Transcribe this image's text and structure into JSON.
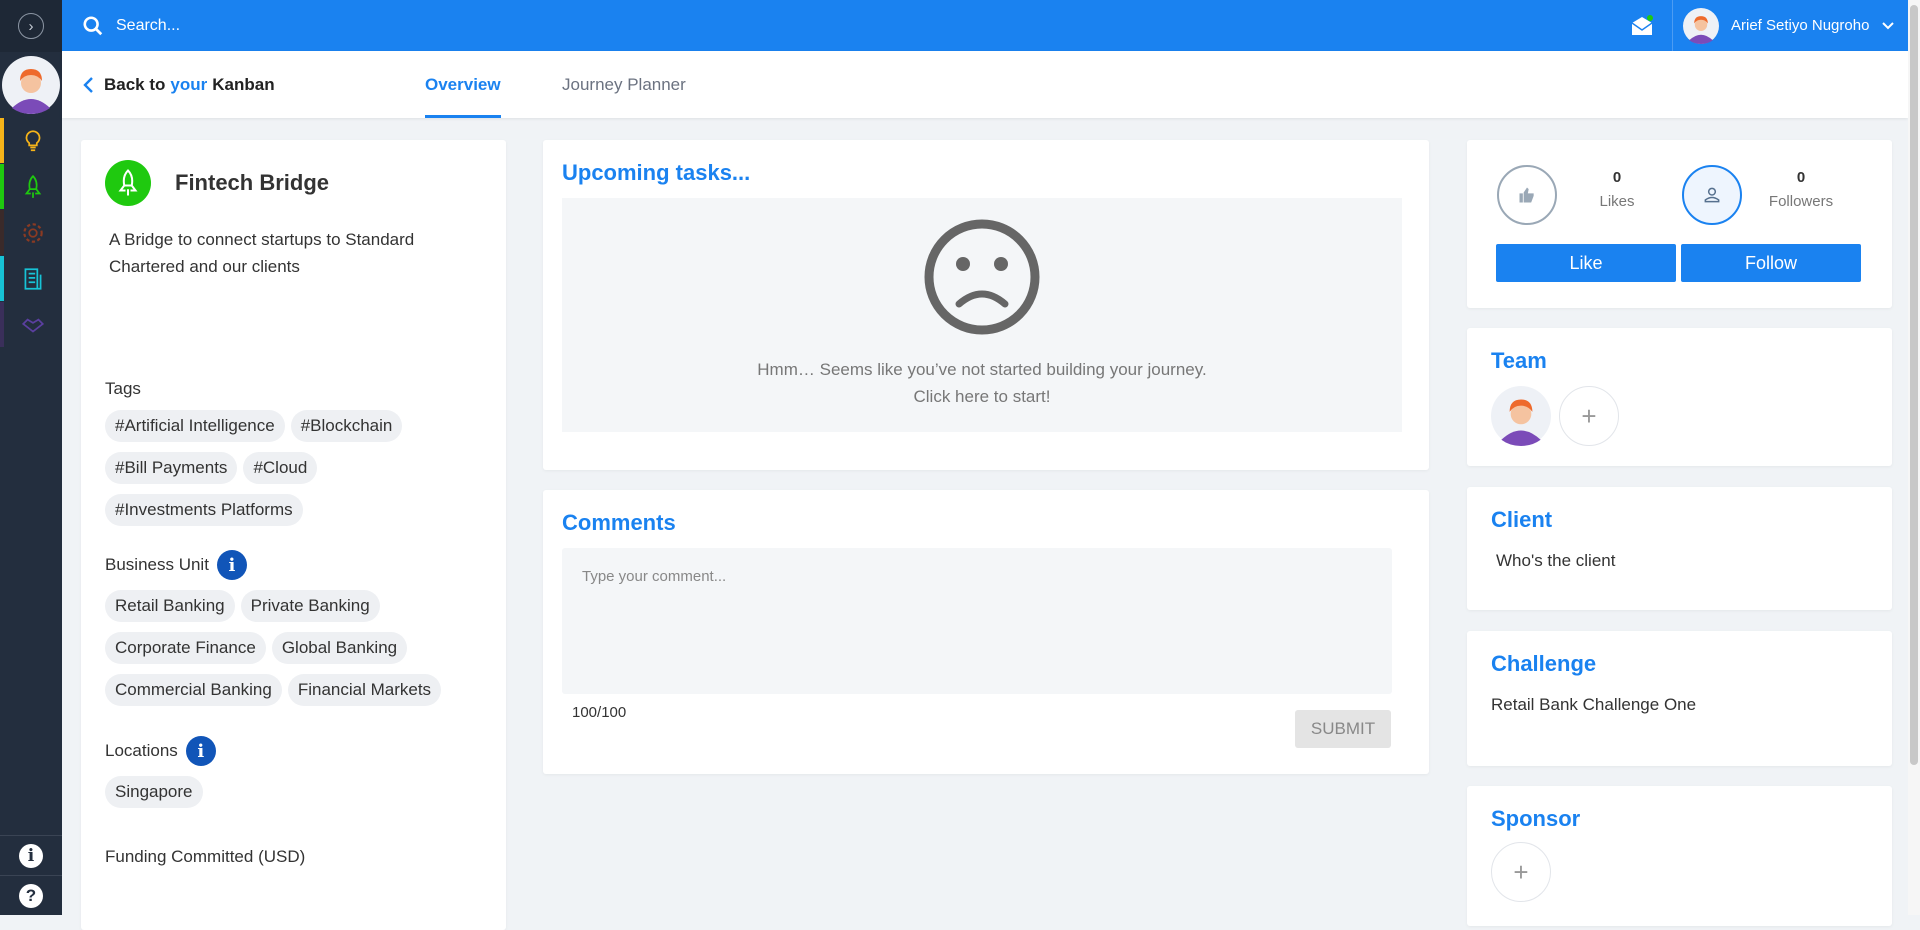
{
  "topbar": {
    "search_placeholder": "Search...",
    "user_name": "Arief Setiyo Nugroho"
  },
  "nav": {
    "back_prefix": "Back to",
    "back_your": "your",
    "back_suffix": "Kanban",
    "tabs": [
      {
        "label": "Overview",
        "active": true
      },
      {
        "label": "Journey Planner",
        "active": false
      }
    ]
  },
  "sidebar": {
    "items": [
      {
        "icon": "lightbulb-icon",
        "color": "#f6b419"
      },
      {
        "icon": "rocket-icon",
        "color": "#1fc90f"
      },
      {
        "icon": "gear-icon",
        "color": "#8b3a22"
      },
      {
        "icon": "document-icon",
        "color": "#17c3d6"
      },
      {
        "icon": "handshake-icon",
        "color": "#5b3fa0"
      }
    ]
  },
  "project": {
    "name": "Fintech Bridge",
    "description": "A Bridge to connect startups to Standard Chartered and our clients",
    "tags_label": "Tags",
    "tags": [
      "#Artificial Intelligence",
      "#Blockchain",
      "#Bill Payments",
      "#Cloud",
      "#Investments Platforms"
    ],
    "business_unit_label": "Business Unit",
    "business_units": [
      "Retail Banking",
      "Private Banking",
      "Corporate Finance",
      "Global Banking",
      "Commercial Banking",
      "Financial Markets"
    ],
    "locations_label": "Locations",
    "locations": [
      "Singapore"
    ],
    "funding_label": "Funding Committed (USD)"
  },
  "upcoming": {
    "title": "Upcoming tasks...",
    "empty_line1": "Hmm… Seems like you’ve not started building your journey.",
    "empty_line2": "Click here to start!"
  },
  "comments": {
    "title": "Comments",
    "placeholder": "Type your comment...",
    "counter": "100/100",
    "submit_label": "SUBMIT"
  },
  "stats": {
    "likes_count": "0",
    "likes_label": "Likes",
    "followers_count": "0",
    "followers_label": "Followers",
    "like_button": "Like",
    "follow_button": "Follow"
  },
  "team": {
    "title": "Team"
  },
  "client": {
    "title": "Client",
    "value": "Who's the client"
  },
  "challenge": {
    "title": "Challenge",
    "value": "Retail Bank Challenge One"
  },
  "sponsor": {
    "title": "Sponsor"
  },
  "colors": {
    "primary": "#1a82f0",
    "sidebar_bg": "#232e3e",
    "project_green": "#1fc90f",
    "info_blue": "#1155b8"
  }
}
